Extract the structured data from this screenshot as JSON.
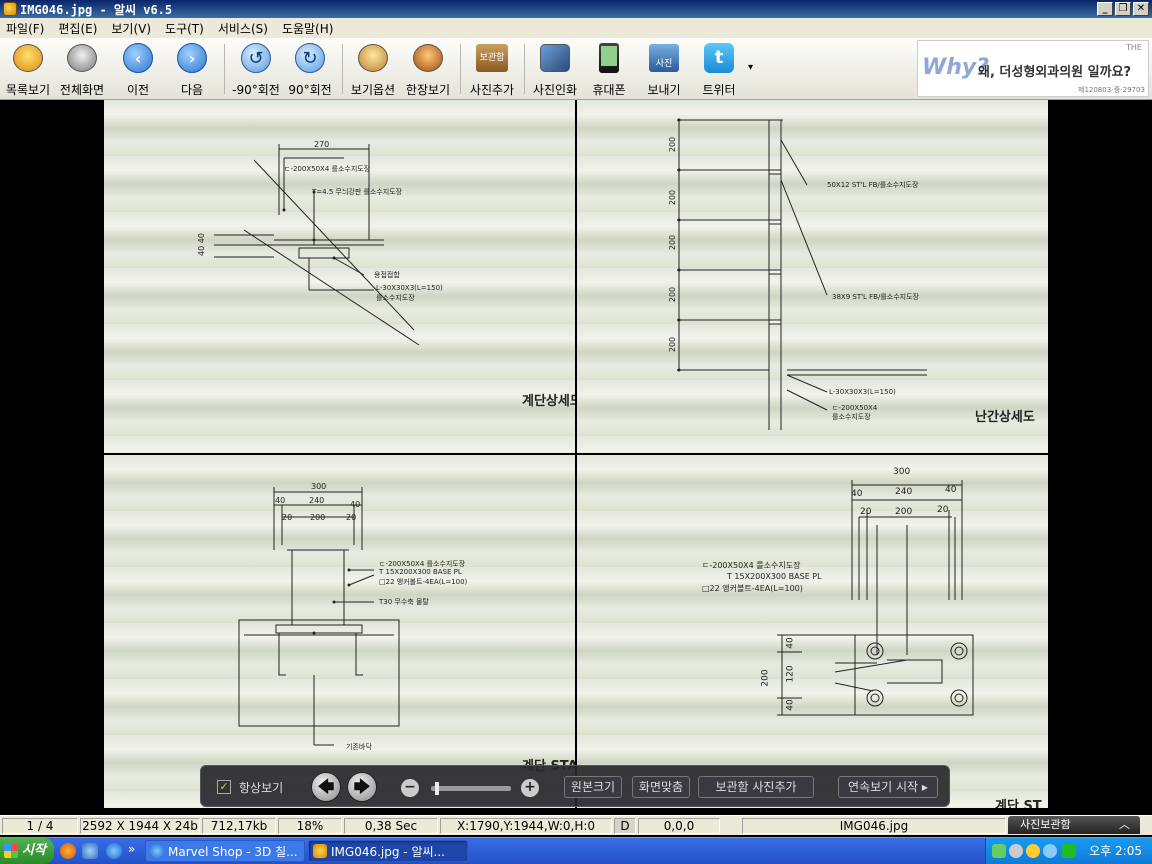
{
  "window": {
    "title": "IMG046.jpg - 알씨 v6.5",
    "controls": [
      "_",
      "❐",
      "✕"
    ]
  },
  "menu": [
    "파일(F)",
    "편집(E)",
    "보기(V)",
    "도구(T)",
    "서비스(S)",
    "도움말(H)"
  ],
  "toolbar": {
    "list_view": "목록보기",
    "full_screen": "전체화면",
    "prev": "이전",
    "next": "다음",
    "rotate_left": "-90°회전",
    "rotate_right": "90°회전",
    "view_options": "보기옵션",
    "single_view": "한장보기",
    "album_badge": "보관함",
    "add_photo": "사진추가",
    "print_photo": "사진인화",
    "phone": "휴대폰",
    "send_badge": "사진",
    "send": "보내기",
    "twitter": "트위터",
    "more": "▾"
  },
  "ad": {
    "why": "Why?",
    "text": "왜, 더성형외과의원 일까요?",
    "brand": "THE",
    "small": "제120803-중-29703"
  },
  "drawings": {
    "q1": {
      "dim": "270",
      "note1": "ㄷ-200X50X4  를소수지도장",
      "note2": "T=4.5 무늬강판  를소수지도장",
      "note3": "용접접합",
      "note4": "L-30X30X3(L=150)",
      "note5": "를소수지도장",
      "dim_left": "40 40",
      "title": "계단상세도"
    },
    "q2": {
      "dims": [
        "200",
        "200",
        "200",
        "200",
        "200"
      ],
      "note1": "50X12 ST'L FB/를소수지도장",
      "note2": "38X9 ST'L FB/를소수지도장",
      "note3": "L-30X30X3(L=150)",
      "note4": "ㄷ-200X50X4",
      "note5": "를소수지도장",
      "title": "난간상세도"
    },
    "q3": {
      "dim_total": "300",
      "dim_a": "40",
      "dim_b": "240",
      "dim_c": "40",
      "dim_d": "20",
      "dim_e": "200",
      "dim_f": "20",
      "note1": "ㄷ-200X50X4    를소수지도장",
      "note2": "T 15X200X300 BASE PL",
      "note3": "□22 앵커볼트-4EA(L=100)",
      "note4": "T30 무수축 몰탈",
      "note5": "기존바닥",
      "title": "계단 STAR"
    },
    "q4": {
      "dim_total": "300",
      "dim_a": "40",
      "dim_b": "240",
      "dim_c": "40",
      "dim_d": "20",
      "dim_e": "200",
      "dim_f": "20",
      "note1": "ㄷ-200X50X4    를소수지도장",
      "note2": "T 15X200X300 BASE PL",
      "note3": "□22 앵커볼트-4EA(L=100)",
      "dim_v_total": "200",
      "dim_v1": "40",
      "dim_v2": "120",
      "dim_v3": "40",
      "title": "계단 ST"
    }
  },
  "controls": {
    "always_show_check": "✓",
    "always_show": "항상보기",
    "prev_arrow": "🡄",
    "next_arrow": "🡆",
    "zoom_out": "−",
    "zoom_in": "+",
    "zoom_level": 0.05,
    "original_size": "원본크기",
    "fit_screen": "화면맞춤",
    "album_add": "보관함 사진추가",
    "slideshow": "연속보기 시작 ▸"
  },
  "status": {
    "index": "1 / 4",
    "dimensions": "2592 X 1944 X 24b",
    "size": "712,17kb",
    "zoom": "18%",
    "time": "0,38 Sec",
    "coords": "X:1790,Y:1944,W:0,H:0",
    "flag": "D",
    "rgb": "0,0,0",
    "filename": "IMG046.jpg",
    "album_tab": "사진보관함",
    "album_chev": "︿"
  },
  "taskbar": {
    "start": "시작",
    "more": "»",
    "task1": "Marvel Shop - 3D 칠...",
    "task2": "IMG046.jpg - 알씨...",
    "clock": "오후 2:05"
  }
}
